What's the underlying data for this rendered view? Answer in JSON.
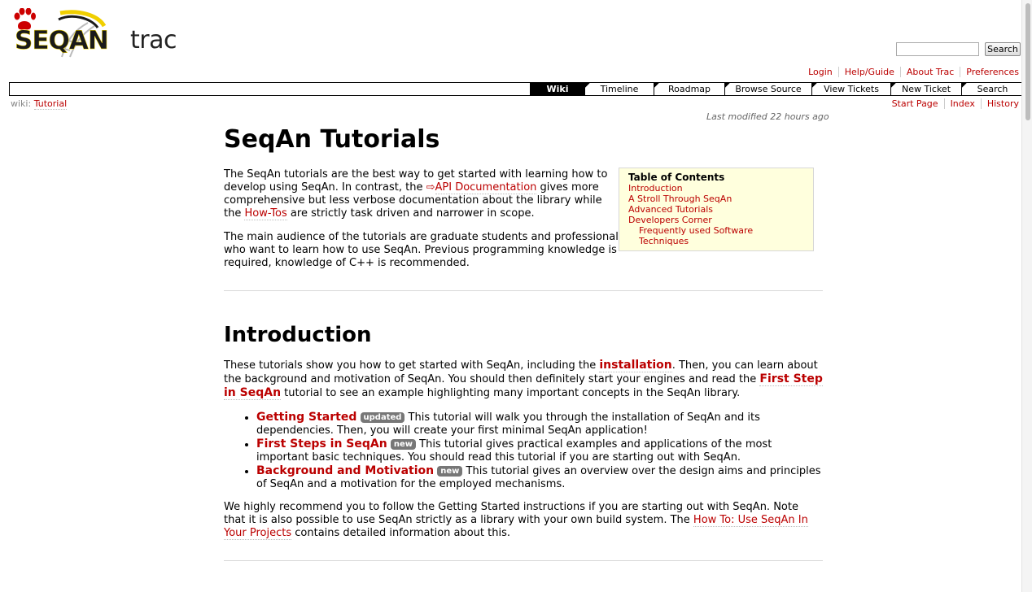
{
  "logo": {
    "seqan": "SEQAN",
    "trac": "trac"
  },
  "search": {
    "placeholder": "",
    "button": "Search"
  },
  "metanav": [
    "Login",
    "Help/Guide",
    "About Trac",
    "Preferences"
  ],
  "mainnav": [
    {
      "label": "Wiki",
      "active": true
    },
    {
      "label": "Timeline"
    },
    {
      "label": "Roadmap"
    },
    {
      "label": "Browse Source"
    },
    {
      "label": "View Tickets"
    },
    {
      "label": "New Ticket"
    },
    {
      "label": "Search"
    }
  ],
  "breadcrumb": {
    "prefix": "wiki:",
    "page": "Tutorial"
  },
  "ctxnav": [
    "Start Page",
    "Index",
    "History"
  ],
  "last_modified": "Last modified 22 hours ago",
  "page": {
    "title": "SeqAn Tutorials",
    "intro_p1": {
      "before": "The SeqAn tutorials are the best way to get started with learning how to develop using SeqAn. In contrast, the ",
      "api_link": "API Documentation",
      "middle": " gives more comprehensive but less verbose documentation about the library while the ",
      "howtos_link": "How-Tos",
      "after": " are strictly task driven and narrower in scope."
    },
    "intro_p2": "The main audience of the tutorials are graduate students and professionals who want to learn how to use SeqAn. Previous programming knowledge is required, knowledge of C++ is recommended."
  },
  "toc": {
    "title": "Table of Contents",
    "items": [
      "Introduction",
      "A Stroll Through SeqAn",
      "Advanced Tutorials",
      "Developers Corner"
    ],
    "subitem": "Frequently used Software Techniques"
  },
  "introduction": {
    "heading": "Introduction",
    "p1": {
      "a": "These tutorials show you how to get started with SeqAn, including the ",
      "installation": "installation",
      "b": ". Then, you can learn about the background and motivation of SeqAn. You should then definitely start your engines and read the ",
      "first_step": "First Step in SeqAn",
      "c": " tutorial to see an example highlighting many important concepts in the SeqAn library."
    },
    "items": [
      {
        "title": "Getting Started",
        "badge": "updated",
        "text": " This tutorial will walk you through the installation of SeqAn and its dependencies. Then, you will create your first minimal SeqAn application!"
      },
      {
        "title": "First Steps in SeqAn",
        "badge": "new",
        "text": " This tutorial gives practical examples and applications of the most important basic techniques. You should read this tutorial if you are starting out with SeqAn."
      },
      {
        "title": "Background and Motivation",
        "badge": "new",
        "text": " This tutorial gives an overview over the design aims and principles of SeqAn and a motivation for the employed mechanisms."
      }
    ],
    "p2": {
      "a": "We highly recommend you to follow the Getting Started instructions if you are starting out with SeqAn. Note that it is also possible to use SeqAn strictly as a library with your own build system. The ",
      "link": "How To: Use SeqAn In Your Projects",
      "b": " contains detailed information about this."
    }
  },
  "colors": {
    "link": "#bb0000",
    "toc_bg": "#ffffdd",
    "badge": "#777777"
  }
}
